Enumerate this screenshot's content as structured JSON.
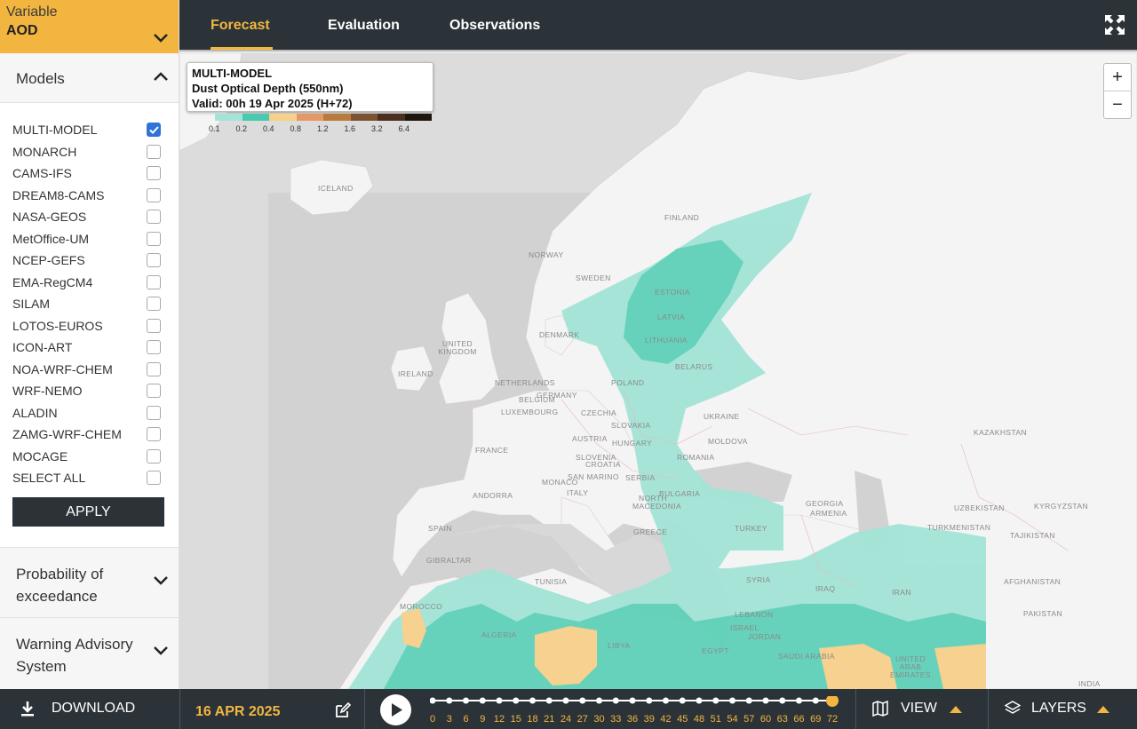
{
  "sidebar": {
    "variable_label": "Variable",
    "variable_value": "AOD",
    "models_title": "Models",
    "models": [
      {
        "label": "MULTI-MODEL",
        "checked": true
      },
      {
        "label": "MONARCH",
        "checked": false
      },
      {
        "label": "CAMS-IFS",
        "checked": false
      },
      {
        "label": "DREAM8-CAMS",
        "checked": false
      },
      {
        "label": "NASA-GEOS",
        "checked": false
      },
      {
        "label": "MetOffice-UM",
        "checked": false
      },
      {
        "label": "NCEP-GEFS",
        "checked": false
      },
      {
        "label": "EMA-RegCM4",
        "checked": false
      },
      {
        "label": "SILAM",
        "checked": false
      },
      {
        "label": "LOTOS-EUROS",
        "checked": false
      },
      {
        "label": "ICON-ART",
        "checked": false
      },
      {
        "label": "NOA-WRF-CHEM",
        "checked": false
      },
      {
        "label": "WRF-NEMO",
        "checked": false
      },
      {
        "label": "ALADIN",
        "checked": false
      },
      {
        "label": "ZAMG-WRF-CHEM",
        "checked": false
      },
      {
        "label": "MOCAGE",
        "checked": false
      },
      {
        "label": "SELECT ALL",
        "checked": false
      }
    ],
    "apply_label": "APPLY",
    "prob_title": "Probability of exceedance",
    "warning_title": "Warning Advisory System"
  },
  "tabs": [
    {
      "label": "Forecast",
      "active": true
    },
    {
      "label": "Evaluation",
      "active": false
    },
    {
      "label": "Observations",
      "active": false
    }
  ],
  "legend": {
    "line1": "MULTI-MODEL",
    "line2": "Dust Optical Depth (550nm)",
    "line3": "Valid: 00h 19 Apr 2025 (H+72)",
    "colors": [
      "#a3e4d7",
      "#48c9b0",
      "#f7d08a",
      "#e59866",
      "#ba7a3c",
      "#7b5232",
      "#4a2f1e",
      "#1f150f"
    ],
    "ticks": [
      "0.1",
      "0.2",
      "0.4",
      "0.8",
      "1.2",
      "1.6",
      "3.2",
      "6.4"
    ]
  },
  "map": {
    "countries": [
      "ICELAND",
      "FINLAND",
      "NORWAY",
      "SWEDEN",
      "ESTONIA",
      "LATVIA",
      "LITHUANIA",
      "DENMARK",
      "UNITED KINGDOM",
      "IRELAND",
      "NETHERLANDS",
      "GERMANY",
      "BELGIUM",
      "LUXEMBOURG",
      "POLAND",
      "BELARUS",
      "CZECHIA",
      "SLOVAKIA",
      "AUSTRIA",
      "HUNGARY",
      "UKRAINE",
      "MOLDOVA",
      "FRANCE",
      "SLOVENIA",
      "CROATIA",
      "ROMANIA",
      "MONACO",
      "SAN MARINO",
      "ANDORRA",
      "ITALY",
      "SERBIA",
      "BULGARIA",
      "NORTH MACEDONIA",
      "SPAIN",
      "GREECE",
      "TURKEY",
      "GEORGIA",
      "ARMENIA",
      "KAZAKHSTAN",
      "UZBEKISTAN",
      "KYRGYZSTAN",
      "TURKMENISTAN",
      "TAJIKISTAN",
      "AFGHANISTAN",
      "PAKISTAN",
      "INDIA",
      "GIBRALTAR",
      "TUNISIA",
      "MOROCCO",
      "ALGERIA",
      "LIBYA",
      "EGYPT",
      "SYRIA",
      "LEBANON",
      "ISRAEL",
      "JORDAN",
      "IRAQ",
      "IRAN",
      "SAUDI ARABIA",
      "UNITED ARAB EMIRATES"
    ],
    "zoom_in": "+",
    "zoom_out": "−"
  },
  "bottom": {
    "download_label": "DOWNLOAD",
    "date": "16 APR 2025",
    "hours": [
      0,
      3,
      6,
      9,
      12,
      15,
      18,
      21,
      24,
      27,
      30,
      33,
      36,
      39,
      42,
      45,
      48,
      51,
      54,
      57,
      60,
      63,
      66,
      69,
      72
    ],
    "current_hour": 72,
    "view_label": "VIEW",
    "layers_label": "LAYERS"
  },
  "colors": {
    "accent": "#f2b640",
    "dark": "#2b3338",
    "checkbox": "#2f73d6"
  }
}
